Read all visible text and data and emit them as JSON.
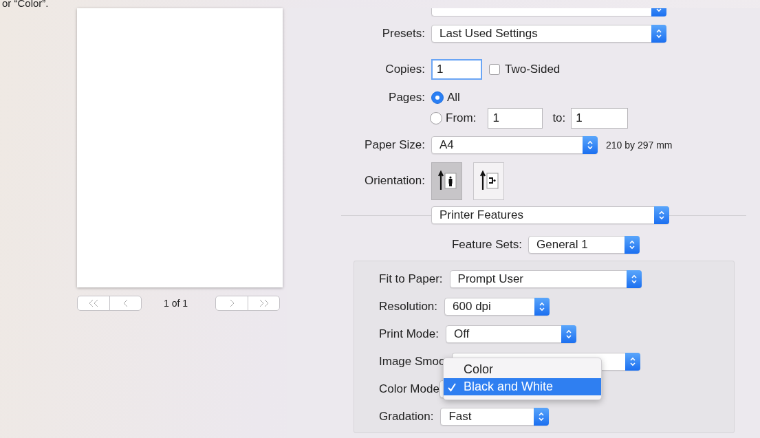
{
  "caption": "or “Color”.",
  "preview": {
    "page_indicator": "1 of 1"
  },
  "presets": {
    "label": "Presets:",
    "value": "Last Used Settings"
  },
  "copies": {
    "label": "Copies:",
    "value": "1"
  },
  "two_sided": {
    "label": "Two-Sided",
    "checked": false
  },
  "pages": {
    "label": "Pages:",
    "options": [
      {
        "label": "All",
        "selected": true
      },
      {
        "label": "From:",
        "selected": false
      }
    ],
    "from": "1",
    "to_label": "to:",
    "to": "1"
  },
  "paper_size": {
    "label": "Paper Size:",
    "value": "A4",
    "note": "210 by 297 mm"
  },
  "orientation": {
    "label": "Orientation:",
    "options": [
      {
        "kind": "portrait",
        "selected": true
      },
      {
        "kind": "landscape",
        "selected": false
      }
    ]
  },
  "section": {
    "value": "Printer Features"
  },
  "feature_sets": {
    "label": "Feature Sets:",
    "value": "General 1"
  },
  "features": [
    {
      "label": "Fit to Paper:",
      "value": "Prompt User"
    },
    {
      "label": "Resolution:",
      "value": "600 dpi"
    },
    {
      "label": "Print Mode:",
      "value": "Off"
    },
    {
      "label": "Image Smoo"
    },
    {
      "label": "Color Mode"
    },
    {
      "label": "Gradation:",
      "value": "Fast"
    }
  ],
  "menu": {
    "items": [
      {
        "label": "Color",
        "selected": false
      },
      {
        "label": "Black and White",
        "selected": true
      }
    ]
  }
}
